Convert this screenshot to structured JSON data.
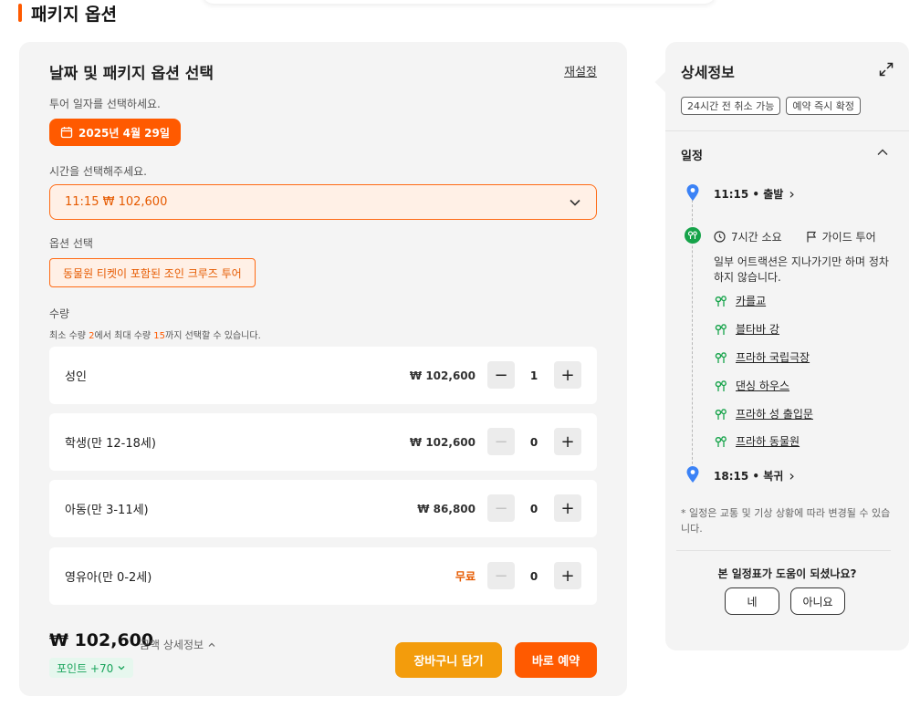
{
  "section": {
    "title": "패키지 옵션"
  },
  "left": {
    "title": "날짜 및 패키지 옵션 선택",
    "reset": "재설정",
    "date_prompt": "투어 일자를 선택하세요.",
    "date_value": "2025년 4월 29일",
    "time_prompt": "시간을 선택해주세요.",
    "time_value": "11:15 ₩ 102,600",
    "option_prompt": "옵션 선택",
    "option_value": "동물원 티켓이 포함된 조인 크루즈 투어",
    "qty_label": "수량",
    "qty_hint": {
      "p1": "최소 수량 ",
      "min": "2",
      "p2": "에서 최대 수량 ",
      "max": "15",
      "p3": "까지 선택할 수 있습니다."
    },
    "rows": [
      {
        "name": "성인",
        "price": "₩ 102,600",
        "qty": "1"
      },
      {
        "name": "학생(만 12-18세)",
        "price": "₩ 102,600",
        "qty": "0"
      },
      {
        "name": "아동(만 3-11세)",
        "price": "₩ 86,800",
        "qty": "0"
      },
      {
        "name": "영유아(만 0-2세)",
        "price": "무료",
        "qty": "0"
      }
    ],
    "total": "₩ 102,600",
    "amount_detail": "금액 상세정보",
    "points": "포인트 +70",
    "cart_button": "장바구니 담기",
    "book_button": "바로 예약"
  },
  "right": {
    "title": "상세정보",
    "tags": [
      "24시간 전 취소 가능",
      "예약 즉시 확정"
    ],
    "schedule_heading": "일정",
    "start": "11:15 • 출발",
    "duration": "7시간 소요",
    "guide": "가이드 투어",
    "description": "일부 어트랙션은 지나가기만 하며 정차하지 않습니다.",
    "attractions": [
      "카를교",
      "블타바 강",
      "프라하 국립극장",
      "댄싱 하우스",
      "프라하 성 출입문",
      "프라하 동물원"
    ],
    "end": "18:15 • 복귀",
    "note": "* 일정은 교통 및 기상 상황에 따라 변경될 수 있습니다.",
    "helpful_question": "본 일정표가 도움이 되셨나요?",
    "yes": "네",
    "no": "아니요"
  },
  "colors": {
    "accent": "#ff5a00",
    "cart": "#f39c0c",
    "points_green": "#17a35a",
    "pin_blue": "#3b82f6",
    "attraction_green": "#16a34a"
  },
  "icons": [
    "calendar-icon",
    "chevron-down-icon",
    "minus-icon",
    "plus-icon",
    "caret-up-icon",
    "chevron-down-small-icon",
    "expand-icon",
    "chevron-up-icon",
    "location-pin-icon",
    "attraction-icon",
    "clock-icon",
    "flag-icon",
    "chevron-right-icon"
  ]
}
